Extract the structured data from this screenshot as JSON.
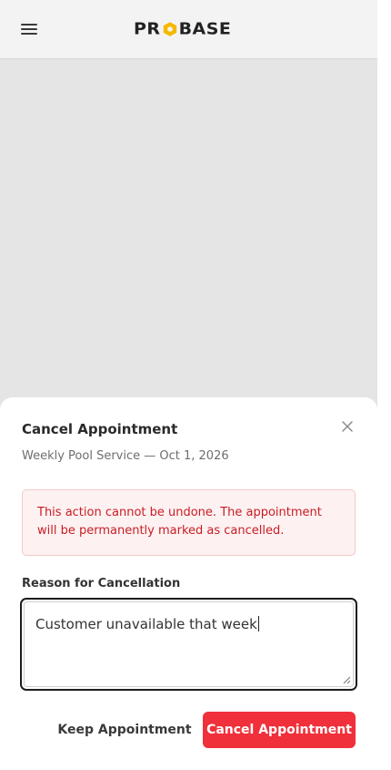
{
  "header": {
    "logo_left": "PR",
    "logo_right": "BASE",
    "menu_icon": "hamburger-menu-icon",
    "logo_hex_color": "#f5b800"
  },
  "modal": {
    "title": "Cancel Appointment",
    "subtitle": "Weekly Pool Service — Oct 1, 2026",
    "close_icon": "close-icon",
    "alert_text": "This action cannot be undone. The appointment will be permanently marked as cancelled.",
    "reason_label": "Reason for Cancellation",
    "reason_value": "Customer unavailable that week",
    "keep_label": "Keep Appointment",
    "confirm_label": "Cancel Appointment"
  },
  "colors": {
    "danger": "#f0303a",
    "alert_bg": "#fdf1f1",
    "alert_text": "#c81d25",
    "backdrop": "#e5e5e5"
  }
}
